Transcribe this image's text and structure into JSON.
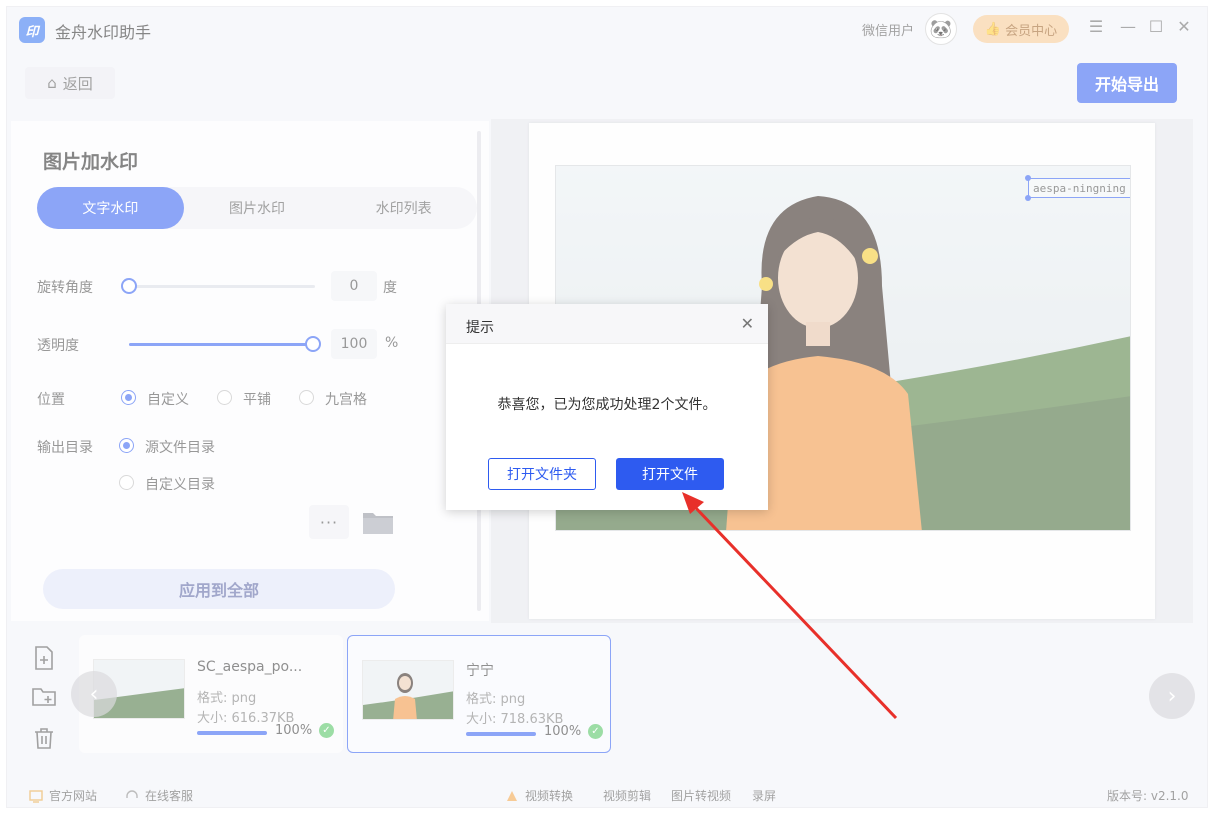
{
  "app": {
    "title": "金舟水印助手",
    "logo_text": "印",
    "user_name": "微信用户",
    "vip_label": "会员中心",
    "accent_color": "#2e5bf0"
  },
  "toolbar": {
    "back_label": "返回",
    "export_label": "开始导出"
  },
  "panel": {
    "title": "图片加水印",
    "tabs": [
      "文字水印",
      "图片水印",
      "水印列表"
    ],
    "active_tab": "文字水印",
    "rotation": {
      "label": "旋转角度",
      "value": "0",
      "unit": "度",
      "fraction": 0
    },
    "opacity": {
      "label": "透明度",
      "value": "100",
      "unit": "%",
      "fraction": 1
    },
    "position": {
      "label": "位置",
      "options": [
        "自定义",
        "平铺",
        "九宫格"
      ],
      "selected": "自定义"
    },
    "output": {
      "label": "输出目录",
      "options": [
        "源文件目录",
        "自定义目录"
      ],
      "selected": "源文件目录"
    },
    "more_label": "···",
    "apply_label": "应用到全部"
  },
  "preview": {
    "watermark_text": "aespa-ningning"
  },
  "files": [
    {
      "name": "SC_aespa_po...",
      "format": "格式: png",
      "size": "大小: 616.37KB",
      "progress": "100%",
      "progress_value": 100,
      "selected": false
    },
    {
      "name": "宁宁",
      "format": "格式: png",
      "size": "大小: 718.63KB",
      "progress": "100%",
      "progress_value": 100,
      "selected": true
    }
  ],
  "footer": {
    "website": "官方网站",
    "service": "在线客服",
    "links": [
      "视频转换",
      "视频剪辑",
      "图片转视频",
      "录屏"
    ],
    "version": "版本号: v2.1.0"
  },
  "dialog": {
    "title": "提示",
    "message": "恭喜您，已为您成功处理2个文件。",
    "open_folder_label": "打开文件夹",
    "open_file_label": "打开文件"
  }
}
